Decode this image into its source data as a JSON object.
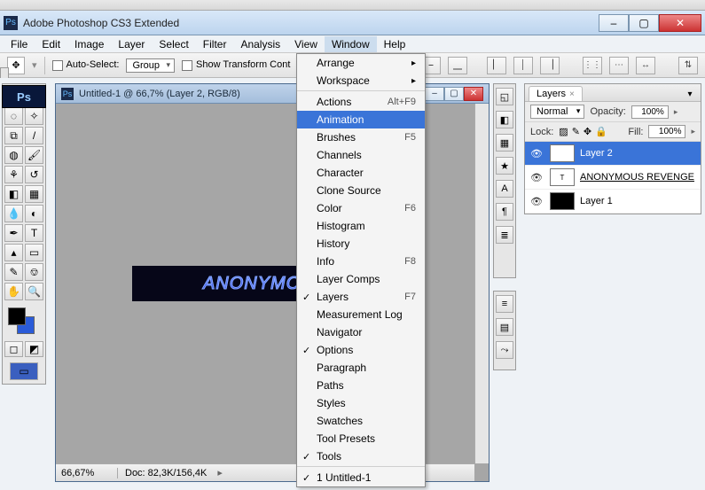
{
  "browser": {
    "visible": true
  },
  "window": {
    "title": "Adobe Photoshop CS3 Extended",
    "buttons": {
      "min": "–",
      "max": "▢",
      "close": "✕"
    }
  },
  "menubar": [
    "File",
    "Edit",
    "Image",
    "Layer",
    "Select",
    "Filter",
    "Analysis",
    "View",
    "Window",
    "Help"
  ],
  "menubar_open_index": 8,
  "options": {
    "auto_select_label": "Auto-Select:",
    "auto_select_value": "Group",
    "show_transform_label": "Show Transform Cont"
  },
  "document": {
    "title": "Untitled-1 @ 66,7% (Layer 2, RGB/8)",
    "artwork_text": "ANONYMOUS",
    "zoom": "66,67%",
    "doc_info": "Doc: 82,3K/156,4K"
  },
  "window_menu": [
    {
      "label": "Arrange",
      "submenu": true
    },
    {
      "label": "Workspace",
      "submenu": true,
      "sep": true
    },
    {
      "label": "Actions",
      "shortcut": "Alt+F9"
    },
    {
      "label": "Animation",
      "highlight": true
    },
    {
      "label": "Brushes",
      "shortcut": "F5"
    },
    {
      "label": "Channels"
    },
    {
      "label": "Character"
    },
    {
      "label": "Clone Source"
    },
    {
      "label": "Color",
      "shortcut": "F6"
    },
    {
      "label": "Histogram"
    },
    {
      "label": "History"
    },
    {
      "label": "Info",
      "shortcut": "F8"
    },
    {
      "label": "Layer Comps"
    },
    {
      "label": "Layers",
      "shortcut": "F7",
      "checked": true
    },
    {
      "label": "Measurement Log"
    },
    {
      "label": "Navigator"
    },
    {
      "label": "Options",
      "checked": true
    },
    {
      "label": "Paragraph"
    },
    {
      "label": "Paths"
    },
    {
      "label": "Styles"
    },
    {
      "label": "Swatches"
    },
    {
      "label": "Tool Presets"
    },
    {
      "label": "Tools",
      "checked": true,
      "sep": true
    },
    {
      "label": "1 Untitled-1",
      "checked": true
    }
  ],
  "layers_panel": {
    "tab": "Layers",
    "blend_mode": "Normal",
    "opacity_label": "Opacity:",
    "opacity_value": "100%",
    "lock_label": "Lock:",
    "fill_label": "Fill:",
    "fill_value": "100%",
    "layers": [
      {
        "visible": true,
        "name": "Layer 2",
        "selected": true,
        "thumb": "light"
      },
      {
        "visible": true,
        "name": "ANONYMOUS REVENGE",
        "type": "text",
        "underline": true
      },
      {
        "visible": true,
        "name": "Layer 1",
        "thumb": "dark"
      }
    ]
  },
  "toolbox_rows": [
    [
      "move",
      "rect-marquee"
    ],
    [
      "lasso",
      "quick-select"
    ],
    [
      "crop",
      "slice"
    ],
    [
      "spot-heal",
      "brush"
    ],
    [
      "stamp",
      "history-brush"
    ],
    [
      "eraser",
      "gradient"
    ],
    [
      "blur",
      "dodge"
    ],
    [
      "pen",
      "type"
    ],
    [
      "path-select",
      "rectangle"
    ],
    [
      "notes",
      "eyedropper"
    ],
    [
      "hand",
      "zoom"
    ]
  ],
  "vdock_a": [
    "navigator-icon",
    "color-icon",
    "swatches-icon",
    "styles-icon",
    "character-icon",
    "paragraph-icon",
    "layer-comps-icon"
  ],
  "vdock_b": [
    "layers-icon",
    "channels-icon",
    "paths-icon"
  ]
}
